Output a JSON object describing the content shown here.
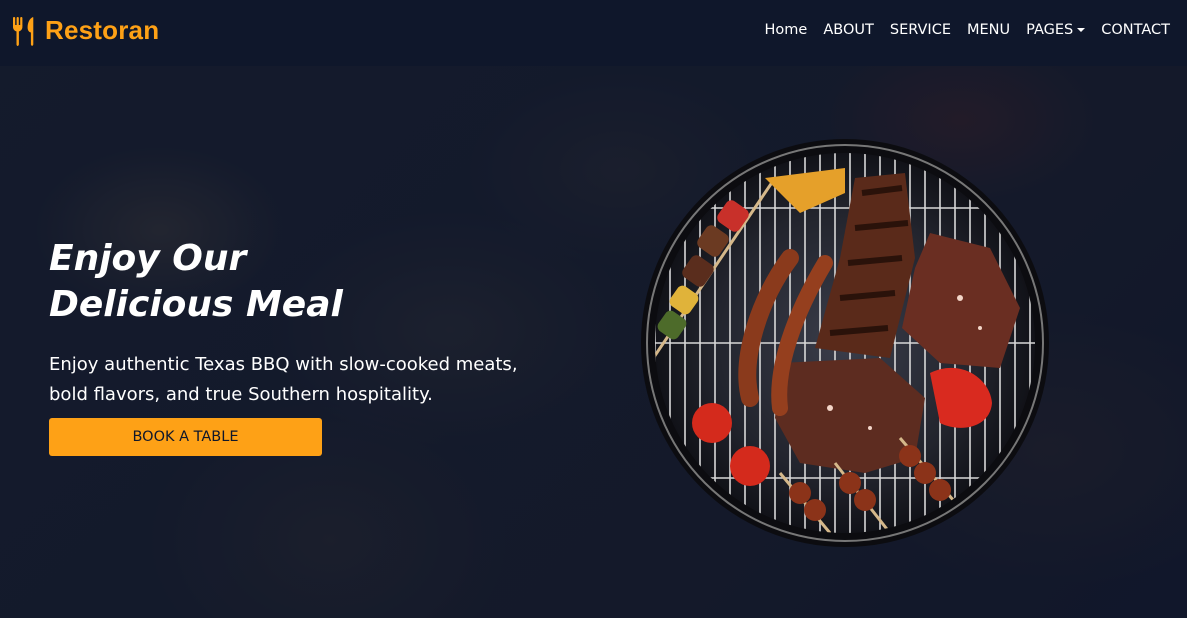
{
  "brand": {
    "name": "Restoran",
    "icon": "utensils-icon",
    "color": "#fea116"
  },
  "nav": [
    {
      "label": "Home"
    },
    {
      "label": "ABOUT"
    },
    {
      "label": "SERVICE"
    },
    {
      "label": "MENU"
    },
    {
      "label": "PAGES",
      "dropdown": true
    },
    {
      "label": "CONTACT"
    }
  ],
  "hero": {
    "title_line1": "Enjoy Our",
    "title_line2": "Delicious Meal",
    "subtitle": "Enjoy authentic Texas BBQ with slow-cooked meats, bold flavors, and true Southern hospitality.",
    "button_label": "BOOK A TABLE"
  },
  "colors": {
    "primary": "#fea116",
    "dark": "#0f172b",
    "text": "#ffffff"
  }
}
